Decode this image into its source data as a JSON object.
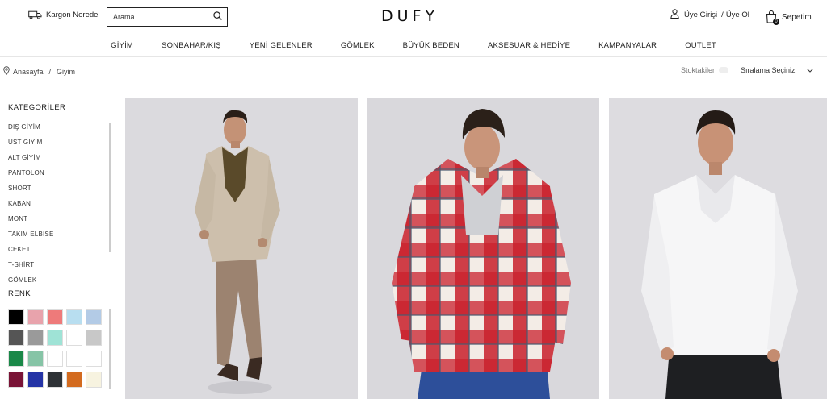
{
  "header": {
    "cargo_label": "Kargon Nerede",
    "search_placeholder": "Arama...",
    "logo": "DUFY",
    "login_label": "Üye Girişi",
    "separator": "/",
    "register_label": "Üye Ol",
    "cart_label": "Sepetim",
    "cart_count": "0"
  },
  "nav": {
    "items": [
      "GİYİM",
      "SONBAHAR/KIŞ",
      "YENİ GELENLER",
      "GÖMLEK",
      "BÜYÜK BEDEN",
      "AKSESUAR & HEDİYE",
      "KAMPANYALAR",
      "OUTLET"
    ]
  },
  "breadcrumb": {
    "home": "Anasayfa",
    "separator": "/",
    "current": "Giyim"
  },
  "toolbar": {
    "in_stock_label": "Stoktakiler",
    "sort_label": "Sıralama Seçiniz"
  },
  "sidebar": {
    "categories_title": "KATEGORİLER",
    "categories": [
      "DIŞ GİYİM",
      "ÜST GİYİM",
      "ALT GİYİM",
      "PANTOLON",
      "SHORT",
      "KABAN",
      "MONT",
      "TAKIM ELBİSE",
      "CEKET",
      "T-SHİRT",
      "GÖMLEK"
    ],
    "color_title": "RENK",
    "colors": [
      "#000000",
      "#e8a3ac",
      "#ee7a7a",
      "#b8def0",
      "#b3cbe6",
      "#555555",
      "#9a9a9a",
      "#9fe3d6",
      "#ffffff",
      "#c8c8c8",
      "#1a8848",
      "#86c4a6",
      "#ffffff",
      "#ffffff",
      "#ffffff",
      "#7a1436",
      "#2534a6",
      "#2e3236",
      "#d36b1f",
      "#f7f3e0"
    ]
  },
  "products": [
    {
      "icon": "beige-suit-model-image"
    },
    {
      "icon": "red-plaid-shirt-model-image"
    },
    {
      "icon": "white-shirt-model-image"
    }
  ]
}
